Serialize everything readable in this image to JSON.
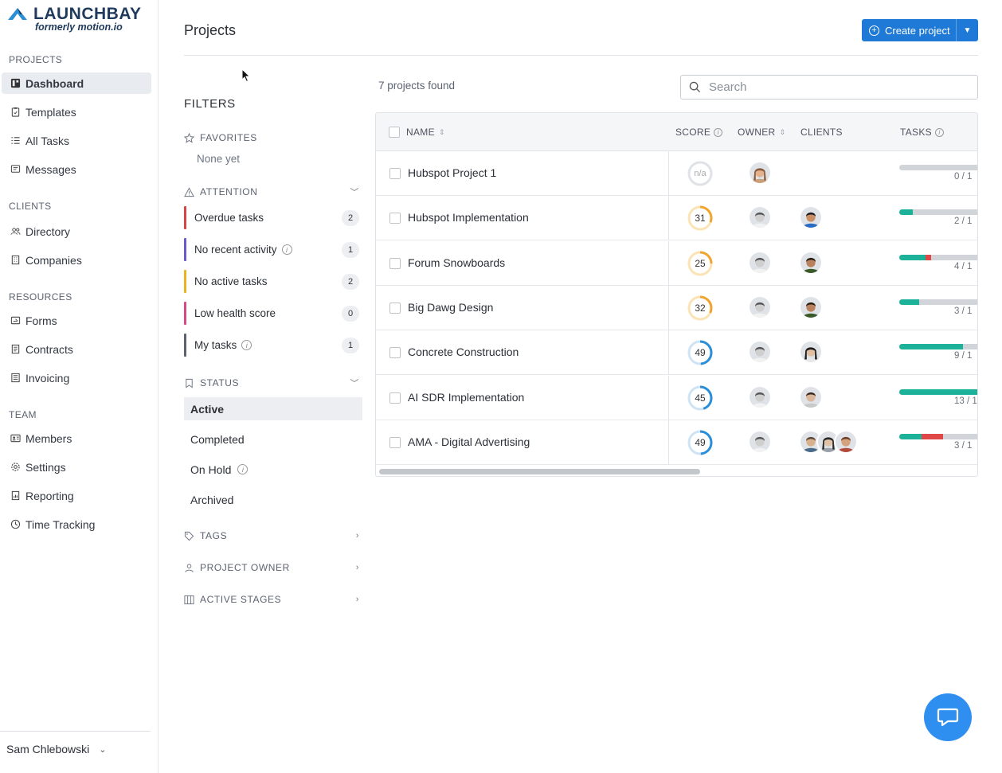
{
  "app": {
    "brand": "LAUNCHBAY",
    "brand_sub": "formerly motion.io"
  },
  "sidebar": {
    "sections": [
      {
        "title": "PROJECTS",
        "items": [
          {
            "label": "Dashboard",
            "icon": "dashboard-icon",
            "active": true
          },
          {
            "label": "Templates",
            "icon": "clipboard-icon"
          },
          {
            "label": "All Tasks",
            "icon": "list-icon"
          },
          {
            "label": "Messages",
            "icon": "message-icon"
          }
        ]
      },
      {
        "title": "CLIENTS",
        "items": [
          {
            "label": "Directory",
            "icon": "people-icon"
          },
          {
            "label": "Companies",
            "icon": "building-icon"
          }
        ]
      },
      {
        "title": "RESOURCES",
        "items": [
          {
            "label": "Forms",
            "icon": "form-icon"
          },
          {
            "label": "Contracts",
            "icon": "document-icon"
          },
          {
            "label": "Invoicing",
            "icon": "invoice-icon"
          }
        ]
      },
      {
        "title": "TEAM",
        "items": [
          {
            "label": "Members",
            "icon": "id-card-icon"
          },
          {
            "label": "Settings",
            "icon": "gear-icon"
          },
          {
            "label": "Reporting",
            "icon": "report-icon"
          },
          {
            "label": "Time Tracking",
            "icon": "clock-icon"
          }
        ]
      }
    ],
    "user": "Sam Chlebowski"
  },
  "header": {
    "title": "Projects",
    "create_label": "Create project"
  },
  "filters": {
    "title": "FILTERS",
    "favorites": {
      "label": "FAVORITES",
      "empty": "None yet"
    },
    "attention": {
      "label": "ATTENTION",
      "items": [
        {
          "label": "Overdue tasks",
          "count": "2",
          "color": "#d64545"
        },
        {
          "label": "No recent activity",
          "count": "1",
          "color": "#6a5acd",
          "info": true
        },
        {
          "label": "No active tasks",
          "count": "2",
          "color": "#e8b51f"
        },
        {
          "label": "Low health score",
          "count": "0",
          "color": "#d64a8c"
        },
        {
          "label": "My tasks",
          "count": "1",
          "color": "#5b6270",
          "info": true
        }
      ]
    },
    "status": {
      "label": "STATUS",
      "items": [
        {
          "label": "Active",
          "active": true
        },
        {
          "label": "Completed"
        },
        {
          "label": "On Hold",
          "info": true
        },
        {
          "label": "Archived"
        }
      ]
    },
    "tags": {
      "label": "TAGS"
    },
    "owner": {
      "label": "PROJECT OWNER"
    },
    "stages": {
      "label": "ACTIVE STAGES"
    }
  },
  "projects": {
    "found_text": "7 projects found",
    "search_placeholder": "Search",
    "columns": {
      "name": "NAME",
      "score": "SCORE",
      "owner": "OWNER",
      "clients": "CLIENTS",
      "tasks": "TASKS"
    },
    "rows": [
      {
        "name": "Hubspot Project 1",
        "score": "n/a",
        "score_pct": 0,
        "score_color": "#d8dbe0",
        "owner": "female-owner",
        "clients": [],
        "done": 0,
        "over": 0,
        "tasks": "0 / 1"
      },
      {
        "name": "Hubspot Implementation",
        "score": "31",
        "score_pct": 31,
        "score_color": "#f0a530",
        "owner": "male-owner",
        "clients": [
          "client-a"
        ],
        "done": 15,
        "over": 0,
        "tasks": "2 / 1"
      },
      {
        "name": "Forum Snowboards",
        "score": "25",
        "score_pct": 25,
        "score_color": "#f0a530",
        "owner": "male-owner",
        "clients": [
          "client-b"
        ],
        "done": 30,
        "over": 6,
        "tasks": "4 / 1"
      },
      {
        "name": "Big Dawg Design",
        "score": "32",
        "score_pct": 32,
        "score_color": "#f0a530",
        "owner": "male-owner",
        "clients": [
          "client-b"
        ],
        "done": 23,
        "over": 0,
        "tasks": "3 / 1"
      },
      {
        "name": "Concrete Construction",
        "score": "49",
        "score_pct": 49,
        "score_color": "#2b8fd8",
        "owner": "male-owner",
        "clients": [
          "client-c"
        ],
        "done": 73,
        "over": 0,
        "tasks": "9 / 1"
      },
      {
        "name": "AI SDR Implementation",
        "score": "45",
        "score_pct": 45,
        "score_color": "#2b8fd8",
        "owner": "male-owner",
        "clients": [
          "client-d"
        ],
        "done": 100,
        "over": 0,
        "tasks": "13 / 1"
      },
      {
        "name": "AMA - Digital Advertising",
        "score": "49",
        "score_pct": 49,
        "score_color": "#2b8fd8",
        "owner": "male-owner",
        "clients": [
          "client-e",
          "client-f",
          "client-g"
        ],
        "done": 25,
        "over": 25,
        "tasks": "3 / 1"
      }
    ]
  },
  "colors": {
    "accent": "#1e7ad6",
    "progress_done": "#1cb29a",
    "progress_over": "#e04848"
  }
}
